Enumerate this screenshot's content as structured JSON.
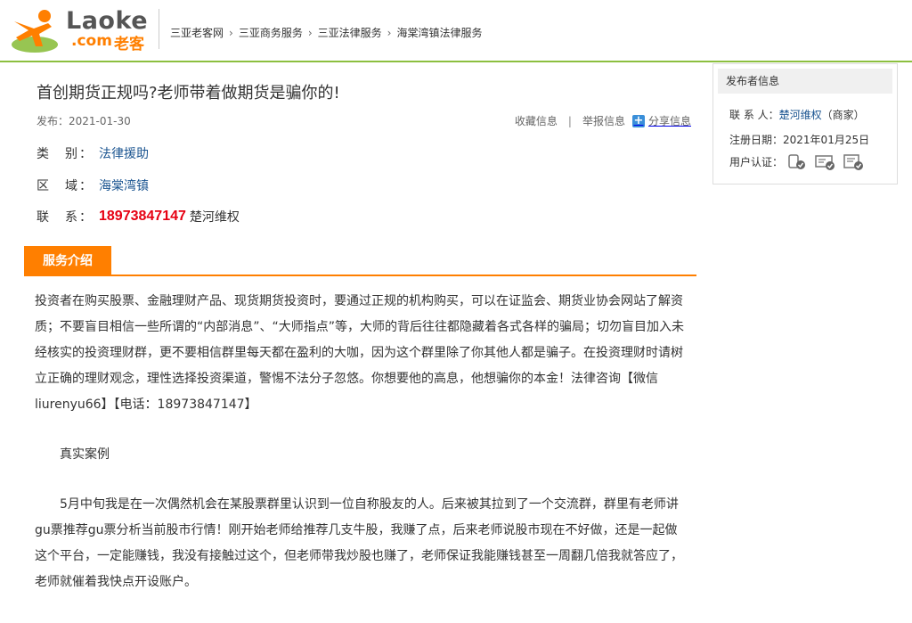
{
  "header": {
    "logo_en": "Laoke",
    "logo_com": ".com",
    "logo_cn": "老客",
    "breadcrumb": [
      "三亚老客网",
      "三亚商务服务",
      "三亚法律服务",
      "海棠湾镇法律服务"
    ]
  },
  "article": {
    "title": "首创期货正规吗?老师带着做期货是骗你的!",
    "date": "发布：2021-01-30",
    "actions": {
      "collect": "收藏信息",
      "report": "举报信息",
      "share": "分享信息"
    },
    "category_label": "类　别：",
    "category": "法律援助",
    "region_label": "区　域：",
    "region": "海棠湾镇",
    "contact_label": "联　系：",
    "phone": "18973847147",
    "contact_name": "楚河维权"
  },
  "section": {
    "tab_label": "服务介绍"
  },
  "content": {
    "p1": "投资者在购买股票、金融理财产品、现货期货投资时，要通过正规的机构购买，可以在证监会、期货业协会网站了解资质；不要盲目相信一些所谓的“内部消息”、“大师指点”等，大师的背后往往都隐藏着各式各样的骗局；切勿盲目加入未经核实的投资理财群，更不要相信群里每天都在盈利的大咖，因为这个群里除了你其他人都是骗子。在投资理财时请树立正确的理财观念，理性选择投资渠道，警惕不法分子忽悠。你想要他的高息，他想骗你的本金！法律咨询【微信liurenyu66】【电话：18973847147】",
    "p2": "真实案例",
    "p3": "5月中旬我是在一次偶然机会在某股票群里认识到一位自称股友的人。后来被其拉到了一个交流群，群里有老师讲gu票推荐gu票分析当前股市行情！刚开始老师给推荐几支牛股，我赚了点，后来老师说股市现在不好做，还是一起做这个平台，一定能赚钱，我没有接触过这个，但老师带我炒股也赚了，老师保证我能赚钱甚至一周翻几倍我就答应了，老师就催着我快点开设账户。"
  },
  "sidebar": {
    "heading": "发布者信息",
    "contact_label": "联 系 人：",
    "contact_name": "楚河维权",
    "contact_type": "（商家）",
    "reg_label": "注册日期：",
    "reg_date": "2021年01月25日",
    "cert_label": "用户认证：",
    "cert_icons": [
      "phone-cert-icon",
      "id-card-cert-icon",
      "business-cert-icon"
    ]
  }
}
